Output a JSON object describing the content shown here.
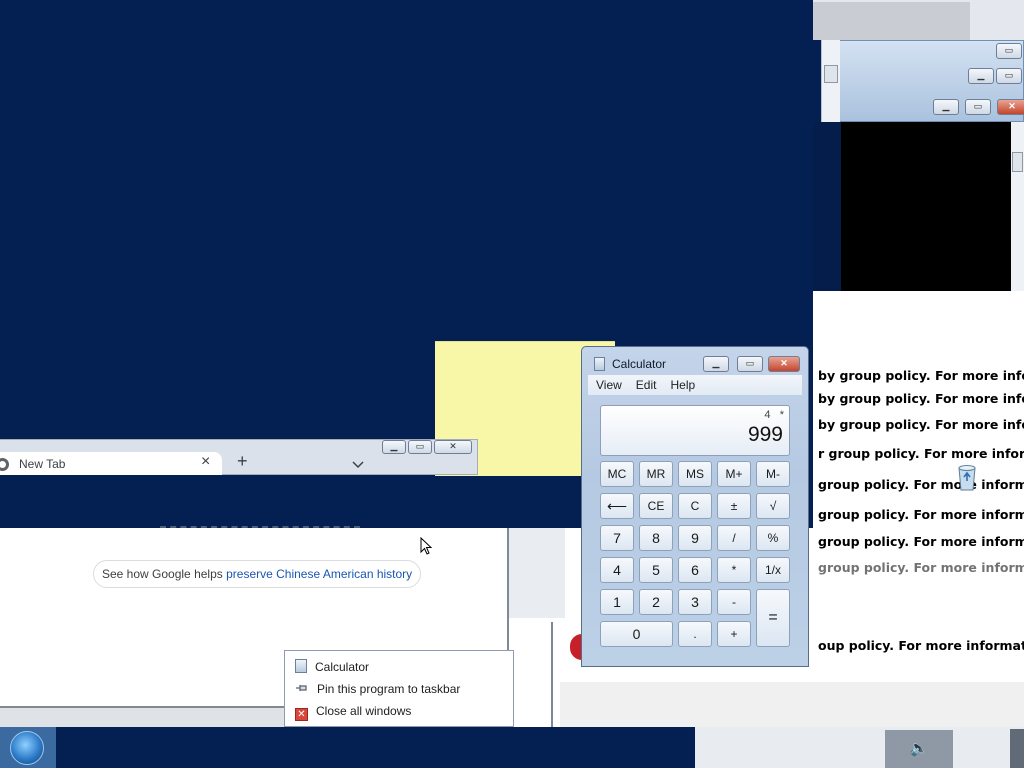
{
  "calculator": {
    "title": "Calculator",
    "menu": [
      "View",
      "Edit",
      "Help"
    ],
    "expression_left": "4",
    "expression_right": "*",
    "display_value": "999",
    "keys": {
      "mc": "MC",
      "mr": "MR",
      "ms": "MS",
      "mplus": "M+",
      "mminus": "M-",
      "back": "⟵",
      "ce": "CE",
      "c": "C",
      "plusminus": "±",
      "sqrt": "√",
      "k7": "7",
      "k8": "8",
      "k9": "9",
      "div": "/",
      "pct": "%",
      "k4": "4",
      "k5": "5",
      "k6": "6",
      "mul": "*",
      "recip": "1/x",
      "k1": "1",
      "k2": "2",
      "k3": "3",
      "sub": "-",
      "eq": "=",
      "k0": "0",
      "dot": ".",
      "add": "+"
    }
  },
  "browser": {
    "tab_title": "New Tab",
    "tab_close": "×",
    "new_tab": "+",
    "tab_list": "⌄",
    "chip_prefix": "See how Google helps ",
    "chip_link": "preserve Chinese American history"
  },
  "jump_list": {
    "items": [
      "Calculator",
      "Pin this program to taskbar",
      "Close all windows"
    ]
  },
  "document_lines": [
    "by group policy. For more informa",
    "by group policy. For more informa",
    "by group policy. For more informa",
    "r group policy. For more informati",
    "group policy. For more information",
    "group policy. For more information",
    "group policy. For more information",
    "group policy. For more information",
    "oup policy. For more information,"
  ],
  "taskbar": {
    "volume_icon": "speaker-icon"
  }
}
